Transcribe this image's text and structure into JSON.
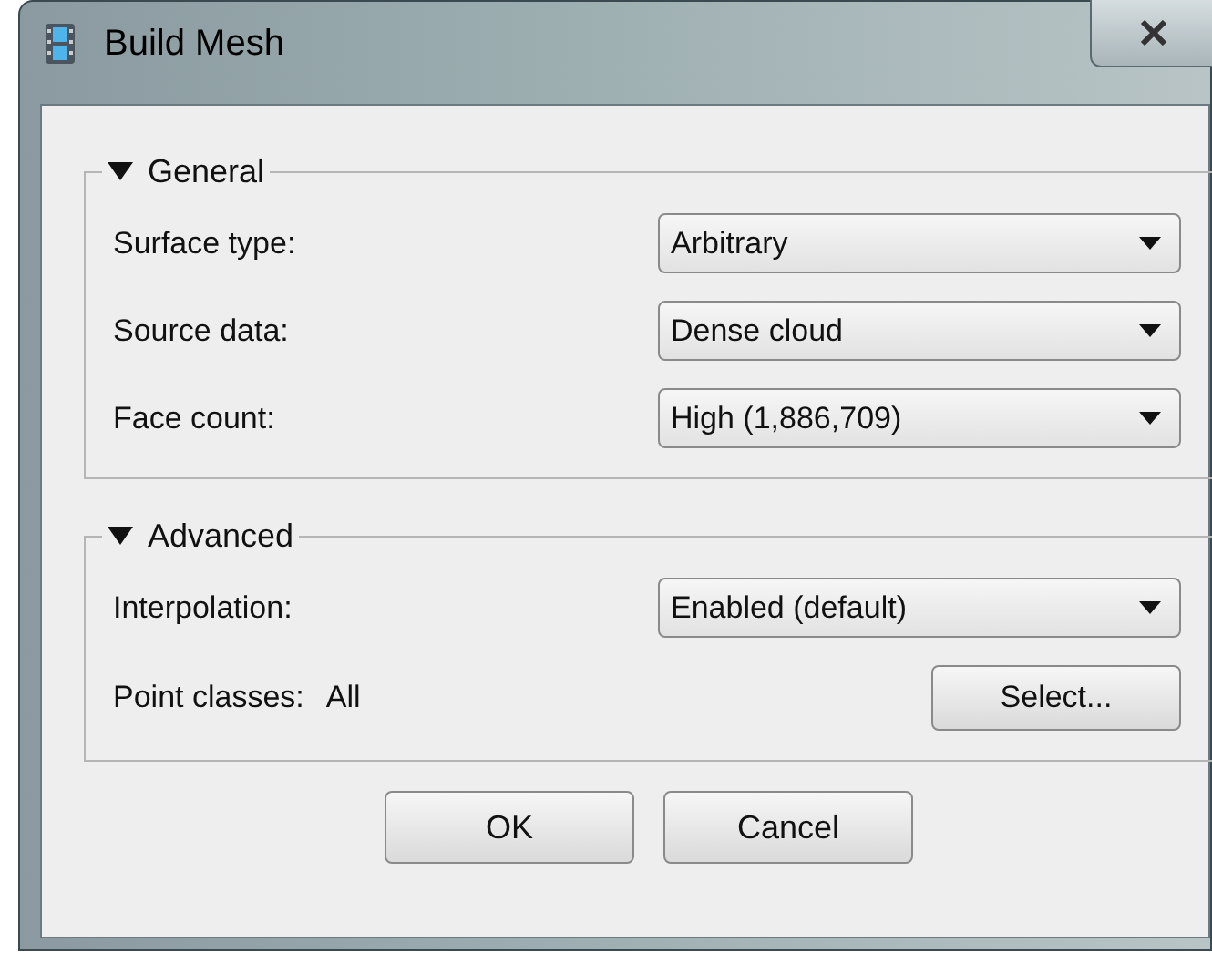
{
  "window": {
    "title": "Build Mesh"
  },
  "groups": [
    {
      "title": "General",
      "expanded": true,
      "rows": [
        {
          "kind": "dropdown",
          "label": "Surface type:",
          "value": "Arbitrary"
        },
        {
          "kind": "dropdown",
          "label": "Source data:",
          "value": "Dense cloud"
        },
        {
          "kind": "dropdown",
          "label": "Face count:",
          "value": "High (1,886,709)"
        }
      ]
    },
    {
      "title": "Advanced",
      "expanded": true,
      "rows": [
        {
          "kind": "dropdown",
          "label": "Interpolation:",
          "value": "Enabled (default)"
        },
        {
          "kind": "button",
          "label": "Point classes:",
          "value": "All",
          "button": "Select..."
        }
      ]
    }
  ],
  "buttons": [
    "OK",
    "Cancel"
  ]
}
